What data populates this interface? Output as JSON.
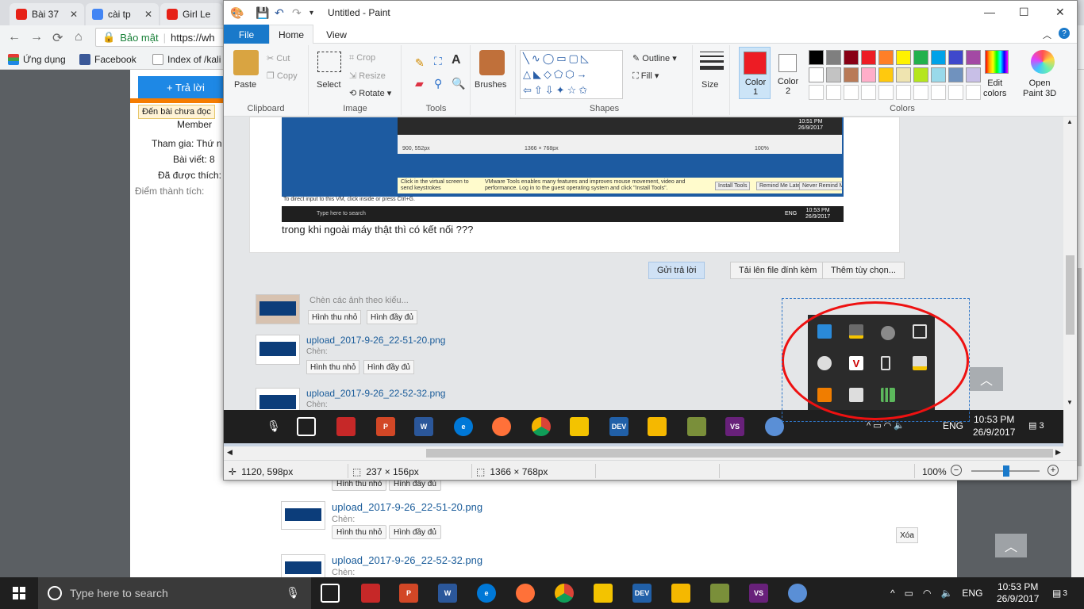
{
  "chrome": {
    "tabs": [
      {
        "label": "Bài 37"
      },
      {
        "label": "cài tp"
      },
      {
        "label": "Girl Le"
      }
    ],
    "address": {
      "secure_label": "Bảo mật",
      "url": "https://wh"
    },
    "bookmarks": [
      {
        "label": "Ứng dụng"
      },
      {
        "label": "Facebook"
      },
      {
        "label": "Index of /kali"
      }
    ]
  },
  "forum": {
    "reply_button": "+ Trả lời",
    "unread_badge": "Đến bài chưa đọc",
    "role": "Member",
    "joined_label": "Tham gia: Thứ n",
    "posts_label": "Bài viết: 8",
    "likes_label": "Đã được thích:",
    "score_label": "Điểm thành tích:",
    "uploads": [
      {
        "thumb_small": "Hình thu nhỏ",
        "thumb_full": "Hình đầy đủ"
      },
      {
        "name": "upload_2017-9-26_22-51-20.png",
        "insert": "Chèn:",
        "thumb_small": "Hình thu nhỏ",
        "thumb_full": "Hình đầy đủ"
      },
      {
        "name": "upload_2017-9-26_22-52-32.png",
        "insert": "Chèn:"
      }
    ],
    "delete_label": "Xóa",
    "scroll_top": "^"
  },
  "paint": {
    "title": "Untitled - Paint",
    "tabs": {
      "file": "File",
      "home": "Home",
      "view": "View"
    },
    "clipboard": {
      "paste": "Paste",
      "cut": "Cut",
      "copy": "Copy",
      "group": "Clipboard"
    },
    "image": {
      "select": "Select",
      "crop": "Crop",
      "resize": "Resize",
      "rotate": "Rotate",
      "group": "Image"
    },
    "tools": {
      "group": "Tools"
    },
    "brushes": "Brushes",
    "shapes": {
      "outline": "Outline",
      "fill": "Fill",
      "group": "Shapes"
    },
    "size": "Size",
    "color1": {
      "line1": "Color",
      "line2": "1",
      "hex": "#ed1c24"
    },
    "color2": {
      "line1": "Color",
      "line2": "2",
      "hex": "#ffffff"
    },
    "colors_group": "Colors",
    "edit_colors": {
      "line1": "Edit",
      "line2": "colors"
    },
    "paint3d": {
      "line1": "Open",
      "line2": "Paint 3D"
    },
    "palette_row1": [
      "#000000",
      "#7f7f7f",
      "#880015",
      "#ed1c24",
      "#ff7f27",
      "#fff200",
      "#22b14c",
      "#00a2e8",
      "#3f48cc",
      "#a349a4"
    ],
    "palette_row2": [
      "#ffffff",
      "#c3c3c3",
      "#b97a57",
      "#ffaec9",
      "#ffc90e",
      "#efe4b0",
      "#b5e61d",
      "#99d9ea",
      "#7092be",
      "#c8bfe7"
    ],
    "status": {
      "cursor": "1120, 598px",
      "selection": "237 × 156px",
      "image_size": "1366 × 768px",
      "zoom": "100%"
    }
  },
  "screenshot": {
    "caption": "trong khi ngoài máy thật thì có kết nối ???",
    "buttons": {
      "send": "Gửi trả lời",
      "upload": "Tải lên file đính kèm",
      "more": "Thêm tùy chọn..."
    },
    "insert_style": "Chèn các ảnh theo kiểu...",
    "rows": [
      {
        "thumb_small": "Hình thu nhỏ",
        "thumb_full": "Hình đầy đủ"
      },
      {
        "name": "upload_2017-9-26_22-51-20.png",
        "insert": "Chèn:",
        "thumb_small": "Hình thu nhỏ",
        "thumb_full": "Hình đầy đủ"
      },
      {
        "name": "upload_2017-9-26_22-52-32.png",
        "insert": "Chèn:"
      }
    ],
    "vm": {
      "clock_time": "10:51 PM",
      "clock_date": "26/9/2017",
      "cursor": "900, 552px",
      "size": "1366 × 768px",
      "zoom": "100%",
      "notice": "Click in the virtual screen to send keystrokes",
      "vmware_msg": "VMware Tools enables many features and improves mouse movement, video and performance. Log in to the guest operating system and click \"Install Tools\".",
      "install": "Install Tools",
      "remind": "Remind Me Later",
      "never": "Never Remind Me",
      "direct": "To direct input to this VM, click inside or press Ctrl+G.",
      "search": "Type here to search",
      "time2": "10:53 PM",
      "date2": "26/9/2017",
      "lang": "ENG"
    },
    "taskbar": {
      "lang": "ENG",
      "time": "10:53 PM",
      "date": "26/9/2017",
      "notif": "3"
    }
  },
  "taskbar": {
    "search_placeholder": "Type here to search",
    "lang": "ENG",
    "time": "10:53 PM",
    "date": "26/9/2017",
    "notif_count": "3"
  },
  "accent": {
    "paint_file": "#1979ca",
    "annotation": "#e11111",
    "selection": "#2f76c7"
  }
}
